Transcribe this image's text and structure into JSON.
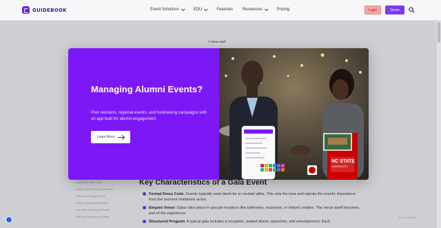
{
  "header": {
    "logo_text": "GUIDEBOOK",
    "nav": [
      {
        "label": "Event Solutions",
        "dropdown": true
      },
      {
        "label": "EDU",
        "dropdown": true
      },
      {
        "label": "Features",
        "dropdown": false
      },
      {
        "label": "Resources",
        "dropdown": true
      },
      {
        "label": "Pricing",
        "dropdown": false
      }
    ],
    "login_label": "Login",
    "demo_label": "Demo"
  },
  "read_time": "7 mins read",
  "modal": {
    "title": "Managing Alumni Events?",
    "description": "Plan reunions, regional events, and fundraising campaigns with an app built for alumni engagement.",
    "button_label": "Learn More",
    "image_alt": "Two alumni shaking hands at an evening event with a phone app and NC State University card"
  },
  "toc": [
    "Grading a Gala Event",
    "Design the Perfect Experience",
    "Plan Your Program Flow",
    "Secure Sponsorship Early",
    "The Gala Planning Process",
    "Set Your Budget and Goals"
  ],
  "article": {
    "heading": "Key Characteristics of a Gala Event",
    "items": [
      {
        "term": "Formal Dress Code",
        "text": ": Guests typically wear black-tie or cocktail attire. This sets the tone and signals the event's importance from the moment invitations arrive."
      },
      {
        "term": "Elegant Venue",
        "text": ": Galas take place in upscale locations like ballrooms, museums, or historic estates. The venue itself becomes part of the experience."
      },
      {
        "term": "Structured Program",
        "text": ": A typical gala includes a reception, seated dinner, speeches, and entertainment. Each"
      }
    ]
  },
  "badge_text": "Bitsol Websites",
  "colors": {
    "brand": "#7c18f5",
    "demo": "#7c3aed",
    "login_bg": "#f2a7a7"
  }
}
